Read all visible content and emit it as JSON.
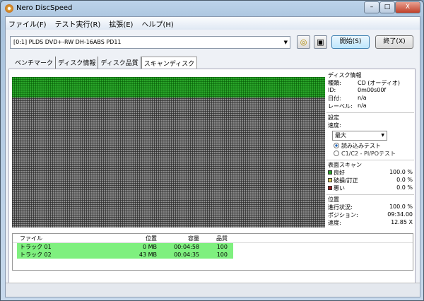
{
  "window": {
    "title": "Nero DiscSpeed",
    "minimize": "–",
    "maximize": "□",
    "close": "X"
  },
  "menu": [
    "ファイル(F)",
    "テスト実行(R)",
    "拡張(E)",
    "ヘルプ(H)"
  ],
  "drive": "[0:1]  PLDS DVD+-RW DH-16ABS PD11",
  "buttons": {
    "start": "開始(S)",
    "exit": "終了(X)"
  },
  "tabs": [
    "ベンチマーク",
    "ディスク情報",
    "ディスク品質",
    "スキャンディスク"
  ],
  "disc_info": {
    "heading": "ディスク情報",
    "type_label": "種類:",
    "type": "CD (オーディオ)",
    "id_label": "ID:",
    "id": "0m00s00f",
    "date_label": "日付:",
    "date": "n/a",
    "level_label": "レーベル:",
    "level": "n/a"
  },
  "settings": {
    "heading": "設定",
    "speed_label": "速度:",
    "speed": "最大",
    "radio1": "読み込みテスト",
    "radio2": "C1/C2 - PI/POテスト"
  },
  "surface": {
    "heading": "表面スキャン",
    "good": "良好",
    "good_val": "100.0 %",
    "damaged": "破損/訂正",
    "damaged_val": "0.0 %",
    "bad": "悪い",
    "bad_val": "0.0 %",
    "colors": {
      "good": "#2aa52a",
      "damaged": "#e0d060",
      "bad": "#a02020"
    }
  },
  "position": {
    "heading": "位置",
    "progress_label": "進行状況:",
    "progress": "100.0 %",
    "pos_label": "ポジション:",
    "pos": "09:34.00",
    "speed_label": "速度:",
    "speed": "12.85 X"
  },
  "list": {
    "headers": [
      "ファイル",
      "位置",
      "容量",
      "品質"
    ],
    "rows": [
      [
        "トラック 01",
        "0 MB",
        "00:04:58",
        "100"
      ],
      [
        "トラック 02",
        "43 MB",
        "00:04:35",
        "100"
      ]
    ]
  }
}
